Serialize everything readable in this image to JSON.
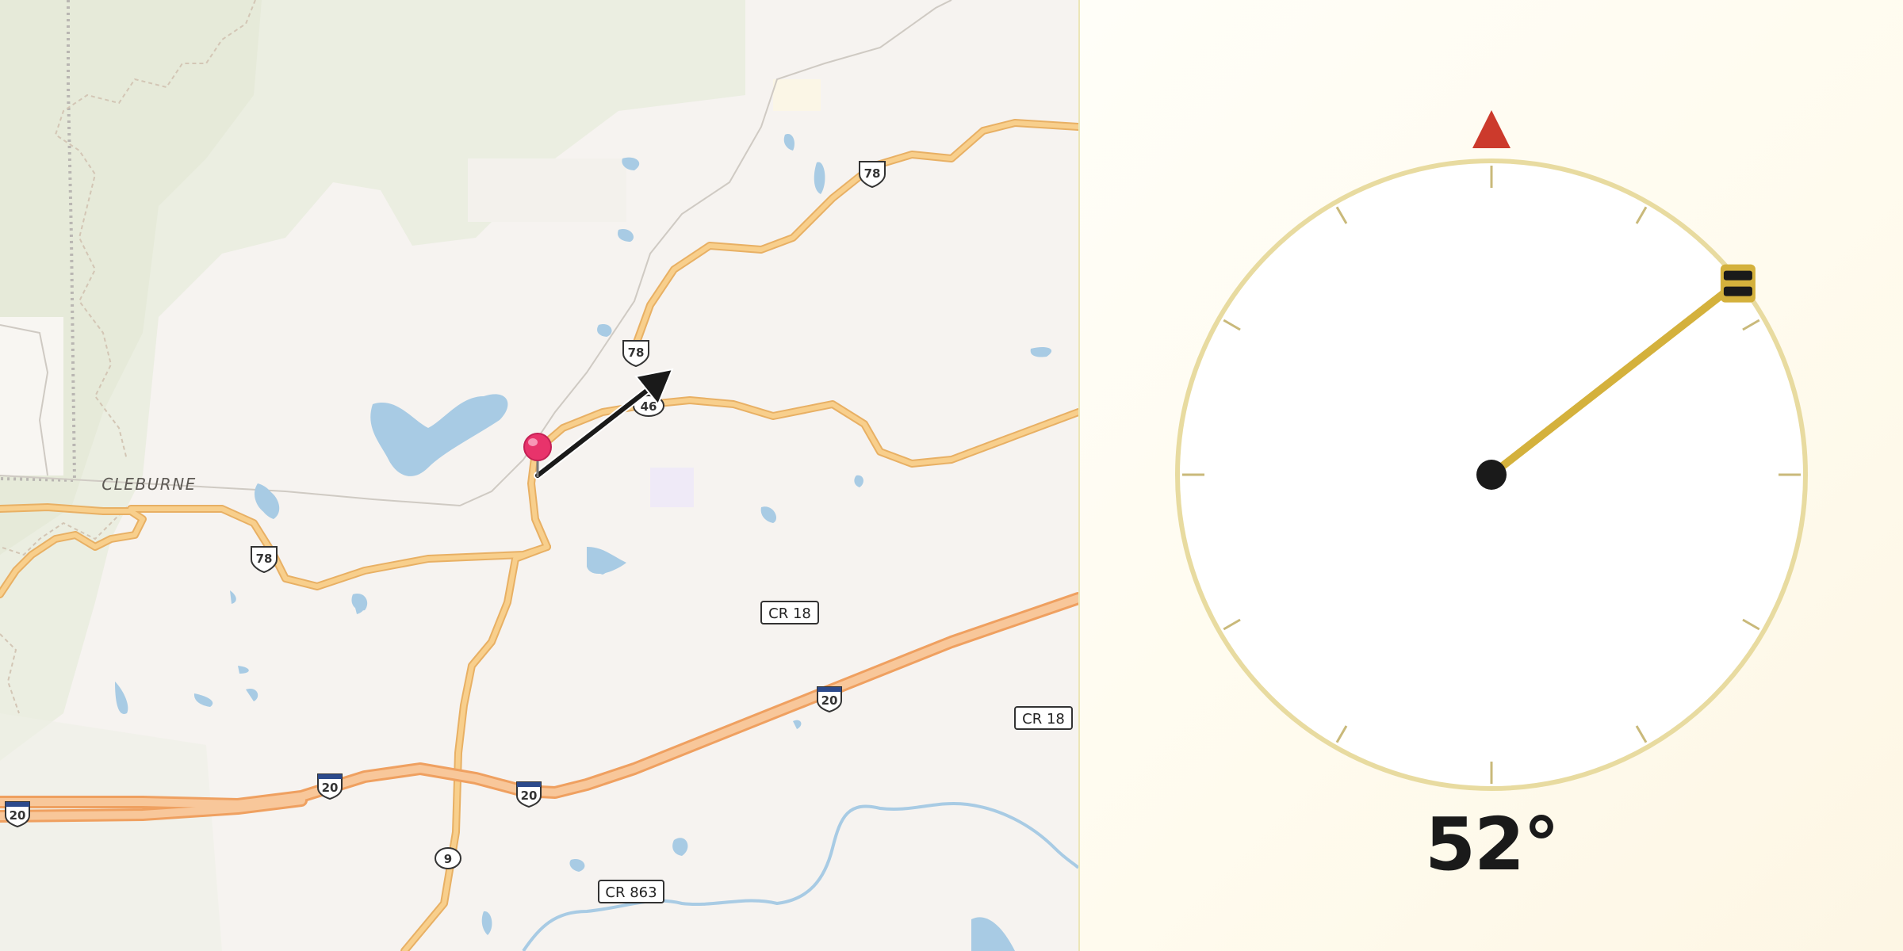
{
  "map": {
    "place_label": "CLEBURNE",
    "route_shields": [
      {
        "kind": "us",
        "number": "78"
      },
      {
        "kind": "us",
        "number": "78"
      },
      {
        "kind": "us",
        "number": "78"
      },
      {
        "kind": "state",
        "number": "46"
      },
      {
        "kind": "state",
        "number": "9"
      },
      {
        "kind": "interstate",
        "number": "20"
      },
      {
        "kind": "interstate",
        "number": "20"
      },
      {
        "kind": "interstate",
        "number": "20"
      },
      {
        "kind": "interstate",
        "number": "20"
      },
      {
        "kind": "county",
        "number": "CR 18"
      },
      {
        "kind": "county",
        "number": "CR 18"
      },
      {
        "kind": "county",
        "number": "CR 863"
      }
    ],
    "marker_icon": "location-pin-icon",
    "direction_arrow_icon": "heading-arrow-icon",
    "colors": {
      "land": "#f6f3f0",
      "forest": "#e9ecde",
      "water": "#a8cbe4",
      "road": "#f8c982",
      "road_casing": "#e8b064",
      "pin": "#e8336b",
      "arrow": "#1a1a1a"
    }
  },
  "compass": {
    "heading_degrees": 52,
    "heading_label": "52°",
    "north_marker_icon": "north-triangle-icon",
    "needle_icon": "compass-needle-icon",
    "colors": {
      "ring": "#e8dba0",
      "needle": "#d4b13c",
      "north_marker": "#cc3a2c",
      "hub": "#1a1a1a",
      "ticks": "#c9b97a"
    }
  }
}
